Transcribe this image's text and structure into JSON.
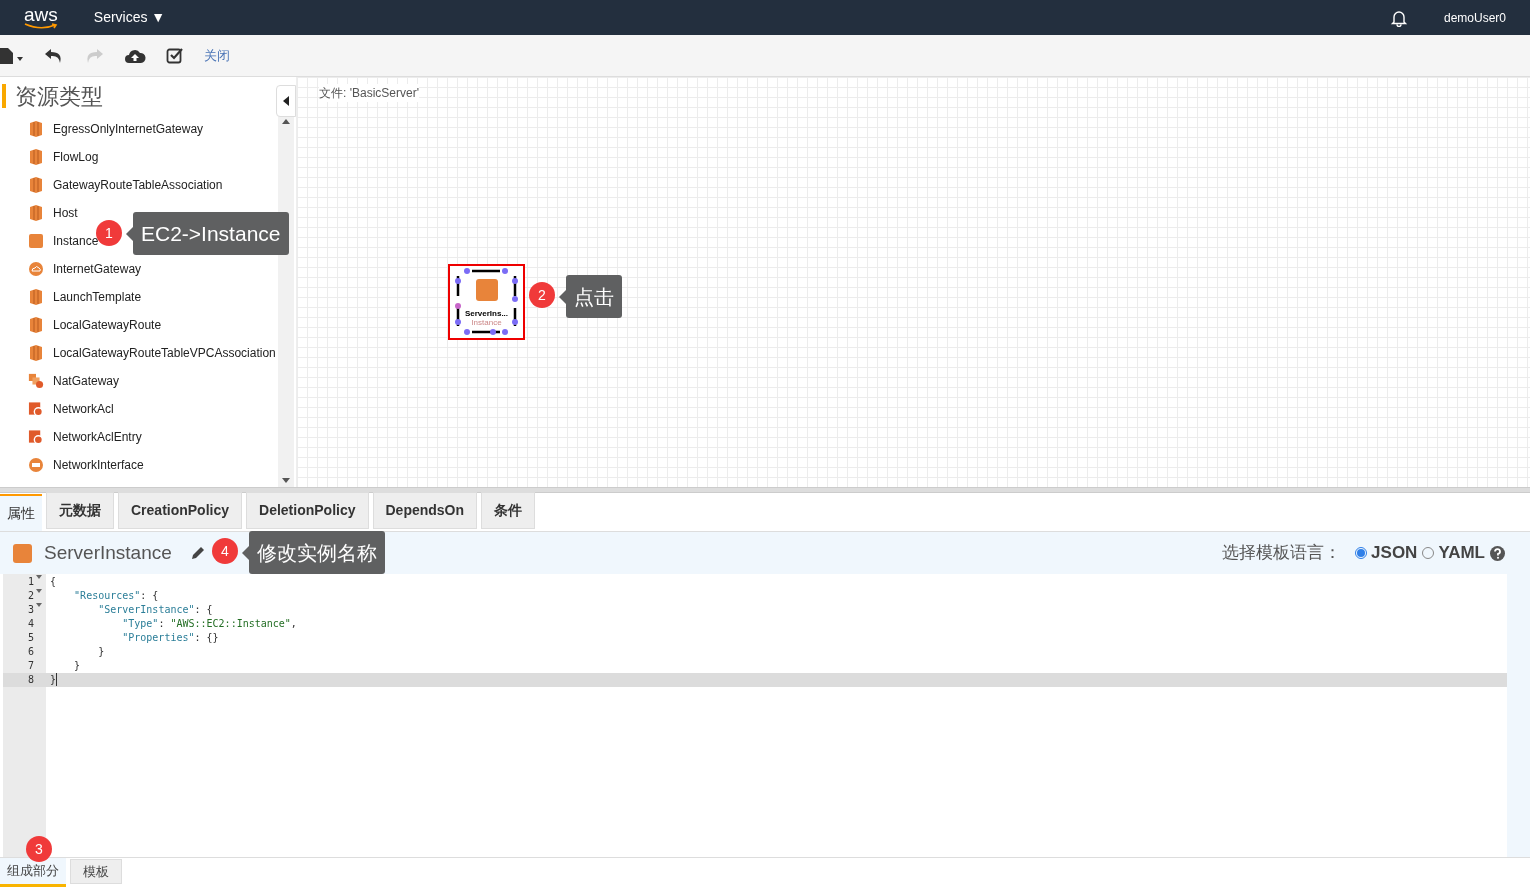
{
  "topbar": {
    "logo": "aws",
    "services": "Services ▼",
    "user": "demoUser0"
  },
  "toolbar": {
    "close": "关闭"
  },
  "sidebar": {
    "title": "资源类型",
    "items": [
      {
        "label": "EgressOnlyInternetGateway",
        "kind": "bars"
      },
      {
        "label": "FlowLog",
        "kind": "bars"
      },
      {
        "label": "GatewayRouteTableAssociation",
        "kind": "bars"
      },
      {
        "label": "Host",
        "kind": "bars"
      },
      {
        "label": "Instance",
        "kind": "square"
      },
      {
        "label": "InternetGateway",
        "kind": "cloud"
      },
      {
        "label": "LaunchTemplate",
        "kind": "bars"
      },
      {
        "label": "LocalGatewayRoute",
        "kind": "bars"
      },
      {
        "label": "LocalGatewayRouteTableVPCAssociation",
        "kind": "bars"
      },
      {
        "label": "NatGateway",
        "kind": "nat"
      },
      {
        "label": "NetworkAcl",
        "kind": "acl"
      },
      {
        "label": "NetworkAclEntry",
        "kind": "acl"
      },
      {
        "label": "NetworkInterface",
        "kind": "eni"
      }
    ]
  },
  "canvas": {
    "file_label": "文件: 'BasicServer'",
    "node": {
      "name": "ServerIns...",
      "type": "Instance",
      "selected": true
    }
  },
  "tabs": [
    {
      "label": "属性",
      "selected": true
    },
    {
      "label": "元数据",
      "selected": false
    },
    {
      "label": "CreationPolicy",
      "selected": false
    },
    {
      "label": "DeletionPolicy",
      "selected": false
    },
    {
      "label": "DependsOn",
      "selected": false
    },
    {
      "label": "条件",
      "selected": false
    }
  ],
  "resource": {
    "name": "ServerInstance",
    "language_label": "选择模板语言：",
    "languages": [
      {
        "label": "JSON",
        "selected": true
      },
      {
        "label": "YAML",
        "selected": false
      }
    ]
  },
  "code": [
    {
      "number": "1",
      "text": "{",
      "foldable": true,
      "active": false
    },
    {
      "number": "2",
      "text": "    \"Resources\": {",
      "foldable": true,
      "active": false
    },
    {
      "number": "3",
      "text": "        \"ServerInstance\": {",
      "foldable": true,
      "active": false
    },
    {
      "number": "4",
      "text": "            \"Type\": \"AWS::EC2::Instance\",",
      "foldable": false,
      "active": false
    },
    {
      "number": "5",
      "text": "            \"Properties\": {}",
      "foldable": false,
      "active": false
    },
    {
      "number": "6",
      "text": "        }",
      "foldable": false,
      "active": false
    },
    {
      "number": "7",
      "text": "    }",
      "foldable": false,
      "active": false
    },
    {
      "number": "8",
      "text": "}",
      "foldable": false,
      "active": true
    }
  ],
  "bottom_tabs": [
    {
      "label": "组成部分",
      "selected": true
    },
    {
      "label": "模板",
      "selected": false
    }
  ],
  "annotations": [
    {
      "number": "1",
      "text": "EC2->Instance"
    },
    {
      "number": "2",
      "text": "点击"
    },
    {
      "number": "3"
    },
    {
      "number": "4",
      "text": "修改实例名称"
    }
  ]
}
